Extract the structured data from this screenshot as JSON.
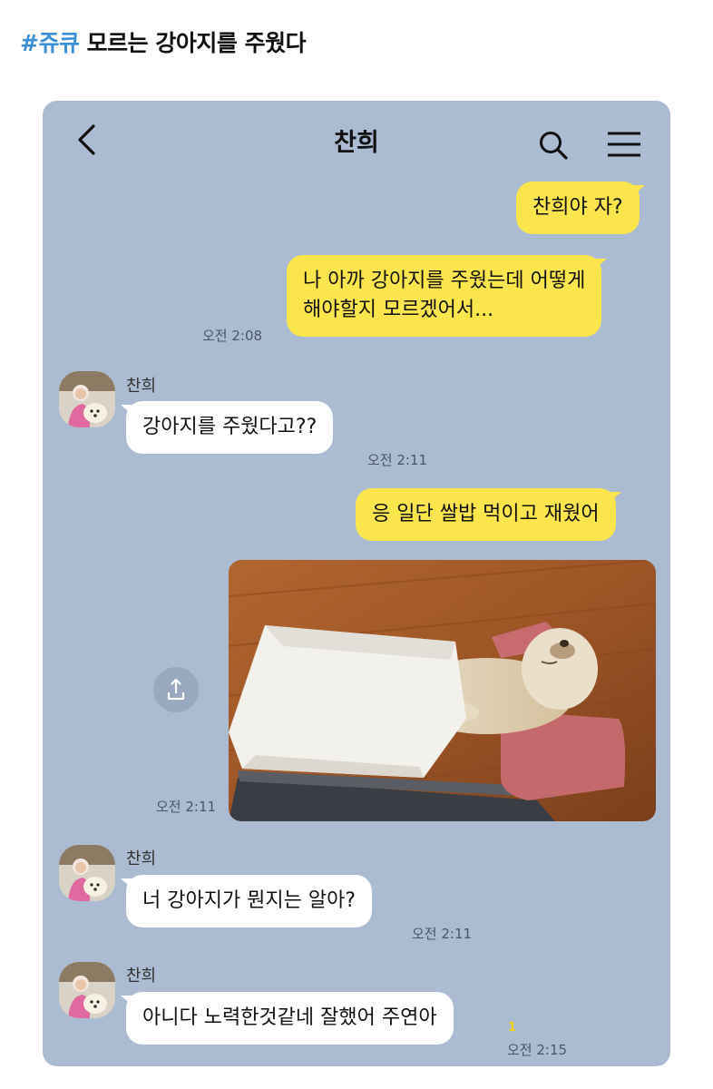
{
  "post": {
    "tag": "#쥬큐",
    "title": "모르는 강아지를 주웠다"
  },
  "chat": {
    "header_title": "찬희",
    "icons": {
      "back": "chevron-left-icon",
      "search": "search-icon",
      "menu": "hamburger-menu-icon",
      "share": "share-icon"
    },
    "colors": {
      "background": "#abbcd2",
      "my_bubble": "#fbe54d",
      "their_bubble": "#ffffff",
      "tag": "#3b8fd6"
    },
    "messages": [
      {
        "from": "me",
        "lines": [
          "찬희야 자?"
        ]
      },
      {
        "from": "me",
        "lines": [
          "나 아까 강아지를 주웠는데 어떻게",
          "해야할지 모르겠어서..."
        ],
        "time": "오전 2:08"
      },
      {
        "from": "them",
        "sender": "찬희",
        "lines": [
          "강아지를 주웠다고??"
        ],
        "time": "오전 2:11"
      },
      {
        "from": "me",
        "lines": [
          "응 일단 쌀밥 먹이고 재웠어"
        ]
      },
      {
        "from": "me",
        "type": "photo",
        "description": "puppy-sleeping-under-tissue-photo",
        "time": "오전 2:11"
      },
      {
        "from": "them",
        "sender": "찬희",
        "lines": [
          "너 강아지가 뭔지는 알아?"
        ],
        "time": "오전 2:11"
      },
      {
        "from": "them",
        "sender": "찬희",
        "lines": [
          "아니다 노력한것같네 잘했어 주연아"
        ],
        "time": "오전 2:15",
        "unread": "1"
      }
    ]
  }
}
